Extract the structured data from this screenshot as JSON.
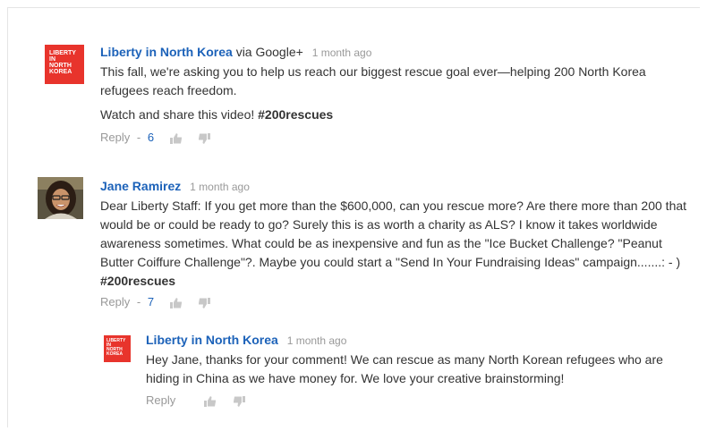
{
  "comments": [
    {
      "author": "Liberty in North Korea",
      "via": "via Google+",
      "time": "1 month ago",
      "avatar_logo_lines": [
        "LIBERTY",
        "IN",
        "NORTH",
        "KOREA"
      ],
      "paragraph1": "This fall, we're asking you to help us reach our biggest rescue goal ever—helping 200 North Korea refugees reach freedom.",
      "paragraph2_text": "Watch and share this video! ",
      "paragraph2_hashtag": "#200rescues",
      "reply_label": "Reply",
      "separator": "-",
      "plus_count": "6"
    },
    {
      "author": "Jane Ramirez",
      "time": "1 month ago",
      "text": "Dear Liberty Staff: If you get more than the $600,000, can you rescue more? Are there more than 200 that would be or could be ready to go?  Surely this is as worth a charity as ALS?  I know it takes worldwide awareness sometimes. What could be as inexpensive and fun as the \"Ice Bucket Challenge? \"Peanut Butter Coiffure Challenge\"?.  Maybe you could start a \"Send In Your Fundraising Ideas\" campaign.......: - ) ",
      "hashtag": "#200rescues",
      "reply_label": "Reply",
      "separator": "-",
      "plus_count": "7"
    },
    {
      "author": "Liberty in North Korea",
      "time": "1 month ago",
      "avatar_logo_lines": [
        "LIBERTY",
        "IN",
        "NORTH",
        "KOREA"
      ],
      "text": "Hey Jane, thanks for your comment! We can rescue as many North Korean refugees who are hiding in China as we have money for. We love your creative brainstorming!",
      "reply_label": "Reply"
    }
  ],
  "colors": {
    "link": "#1c62b9",
    "muted": "#999999",
    "logo_red": "#e8342c"
  },
  "icons": [
    "thumbs-up-icon",
    "thumbs-down-icon"
  ]
}
